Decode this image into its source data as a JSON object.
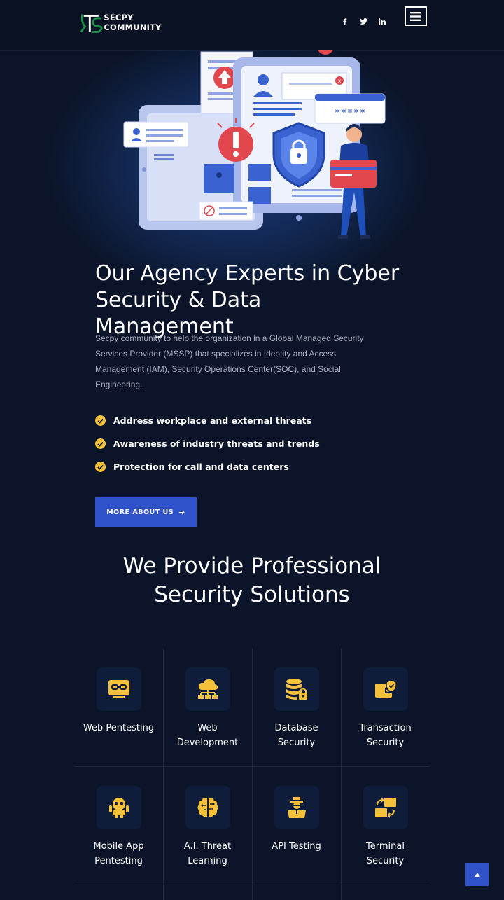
{
  "header": {
    "brand": "SECPY COMMUNITY",
    "social": [
      {
        "icon": "facebook-icon",
        "glyph": "f"
      },
      {
        "icon": "twitter-icon",
        "glyph": "t"
      },
      {
        "icon": "linkedin-icon",
        "glyph": "in"
      }
    ],
    "menu_icon": "hamburger-menu-icon"
  },
  "hero": {
    "password_mask": "*****",
    "alert_mark": "x"
  },
  "about": {
    "title": "Our Agency Experts in Cyber Security & Data Management",
    "description": "Secpy community to help the organization in a Global Managed Security Services Provider (MSSP) that specializes in Identity and Access Management (IAM), Security Operations Center(SOC), and Social Engineering.",
    "checklist": [
      "Address workplace and external threats",
      "Awareness of industry threats and trends",
      "Protection for call and data centers"
    ],
    "button_label": "MORE ABOUT US"
  },
  "services": {
    "title": "We Provide Professional Security Solutions",
    "items": [
      {
        "label": "Web Pentesting",
        "icon": "web-pentest-icon"
      },
      {
        "label": "Web Development",
        "icon": "cloud-network-icon"
      },
      {
        "label": "Database Security",
        "icon": "database-lock-icon"
      },
      {
        "label": "Transaction Security",
        "icon": "secure-wallet-icon"
      },
      {
        "label": "Mobile App Pentesting",
        "icon": "robot-icon"
      },
      {
        "label": "A.I. Threat Learning",
        "icon": "brain-icon"
      },
      {
        "label": "API Testing",
        "icon": "api-icon"
      },
      {
        "label": "Terminal Security",
        "icon": "transfer-icon"
      }
    ]
  },
  "colors": {
    "background": "#0b1428",
    "accent_blue": "#2f51c9",
    "accent_yellow": "#f5c13a"
  }
}
